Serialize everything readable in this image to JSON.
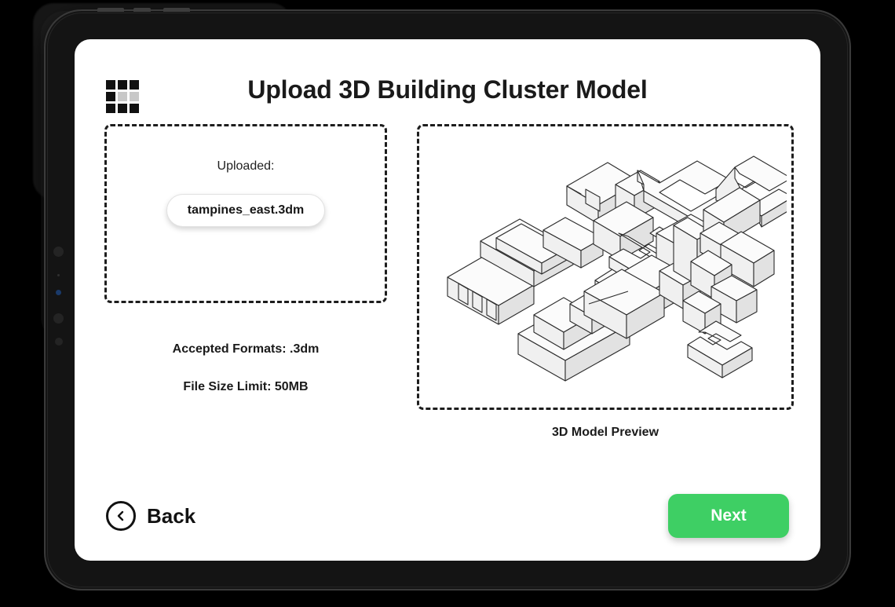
{
  "header": {
    "title": "Upload 3D Building Cluster Model",
    "logo_name": "grid-logo"
  },
  "upload_panel": {
    "uploaded_label": "Uploaded:",
    "file_name": "tampines_east.3dm",
    "accepted_formats": "Accepted Formats: .3dm",
    "file_size_limit": "File Size Limit: 50MB"
  },
  "preview_panel": {
    "caption": "3D Model Preview",
    "model_description": "isometric 3D line drawing of extruded building footprint blocks"
  },
  "footer": {
    "back_label": "Back",
    "next_label": "Next"
  },
  "colors": {
    "accent_green": "#3ecf64",
    "text_dark": "#1a1a1a",
    "dashed_border": "#1d1d1d",
    "device_frame": "#141414"
  }
}
